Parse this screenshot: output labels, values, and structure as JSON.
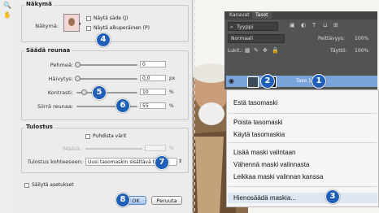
{
  "tools": {
    "zoom_icon": "🔍",
    "hand_icon": "✋"
  },
  "view": {
    "title": "Näkymä",
    "label": "Näkymä:",
    "show_radius": "Näytä säde (J)",
    "show_original": "Näytä alkuperäinen (P)"
  },
  "adjust": {
    "title": "Säädä reunaa",
    "rows": [
      {
        "label": "Pehmeä:",
        "value": "0",
        "unit": "",
        "level": 0.0
      },
      {
        "label": "Häivytys:",
        "value": "0,0",
        "unit": "px",
        "level": 0.0
      },
      {
        "label": "Kontrasti:",
        "value": "10",
        "unit": "%",
        "level": 0.1
      },
      {
        "label": "Siirrä reunaa:",
        "value": "55",
        "unit": "%",
        "level": 0.78
      }
    ]
  },
  "output": {
    "title": "Tulostus",
    "decontaminate": "Puhdista värit",
    "amount_label": "Määrä:",
    "output_to_label": "Tulostus kohteeseen:",
    "output_to_value": "Uusi tasomaskin sisältävä taso"
  },
  "remember": "Säilytä asetukset",
  "buttons": {
    "ok": "OK",
    "cancel": "Peruuta"
  },
  "layers_panel": {
    "tabs": [
      "Kanavat",
      "Tasot"
    ],
    "search": "Tyyppi",
    "blend": "Normaali",
    "opacity_label": "Peittävyys:",
    "opacity_value": "100%",
    "lock_label": "Lukit.:",
    "fill_label": "Täyttö:",
    "fill_value": "100%",
    "layer_name": "Taso 1"
  },
  "context_menu": {
    "items": [
      {
        "label": "Estä tasomaski"
      },
      {
        "label": "Poista tasomaski"
      },
      {
        "label": "Käytä tasomaskia"
      },
      {
        "label": "Lisää maski valintaan"
      },
      {
        "label": "Vähennä maski valinnasta"
      },
      {
        "label": "Leikkaa maski valinnan kanssa"
      },
      {
        "label": "Hienosäädä maskia..."
      }
    ]
  },
  "badges": [
    "1",
    "2",
    "3",
    "4",
    "5",
    "6",
    "7",
    "8"
  ]
}
